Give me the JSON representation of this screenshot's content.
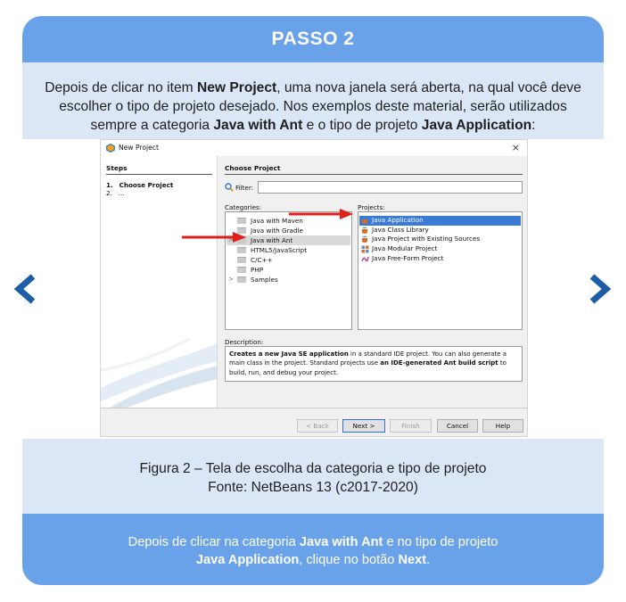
{
  "header": {
    "title": "PASSO 2"
  },
  "intro": {
    "p1": "Depois de clicar no item ",
    "b1": "New Project",
    "p2": ", uma nova janela será aberta, na qual você deve escolher o tipo de projeto desejado. Nos exemplos deste material, serão utilizados sempre a categoria ",
    "b2": "Java with Ant",
    "p3": " e o tipo de projeto ",
    "b3": "Java Application",
    "p4": ":"
  },
  "dialog": {
    "title": "New Project",
    "close": "×",
    "steps_header": "Steps",
    "steps": [
      {
        "num": "1.",
        "label": "Choose Project"
      },
      {
        "num": "2.",
        "label": "..."
      }
    ],
    "choose_header": "Choose Project",
    "filter_label": "Filter:",
    "filter_value": "",
    "categories_label": "Categories:",
    "projects_label": "Projects:",
    "categories": [
      {
        "label": "Java with Maven",
        "expander": ""
      },
      {
        "label": "Java with Gradle",
        "expander": ""
      },
      {
        "label": "Java with Ant",
        "expander": ">",
        "selected": true
      },
      {
        "label": "HTML5/JavaScript",
        "expander": ""
      },
      {
        "label": "C/C++",
        "expander": ""
      },
      {
        "label": "PHP",
        "expander": ""
      },
      {
        "label": "Samples",
        "expander": ">"
      }
    ],
    "projects": [
      {
        "label": "Java Application",
        "icon": "coffee-cup-icon",
        "selected": true
      },
      {
        "label": "Java Class Library",
        "icon": "coffee-cup-icon"
      },
      {
        "label": "Java Project with Existing Sources",
        "icon": "coffee-cup-icon"
      },
      {
        "label": "Java Modular Project",
        "icon": "modules-icon"
      },
      {
        "label": "Java Free-Form Project",
        "icon": "free-form-icon"
      }
    ],
    "description_label": "Description:",
    "description": {
      "b1": "Creates a new Java SE application",
      "t1": " in a standard IDE project. You can also generate a main class in the project. Standard projects use ",
      "b2": "an IDE-generated Ant build script",
      "t2": " to build, run, and debug your project."
    },
    "buttons": {
      "back": "< Back",
      "next": "Next >",
      "finish": "Finish",
      "cancel": "Cancel",
      "help": "Help"
    }
  },
  "caption": {
    "line1": "Figura 2 – Tela de escolha da categoria e tipo de projeto",
    "line2": "Fonte: NetBeans 13 (c2017-2020)"
  },
  "footer": {
    "p1": "Depois de clicar na categoria ",
    "b1": "Java with Ant",
    "p2": " e no tipo de projeto",
    "b2": "Java Application",
    "p3": ", clique no botão ",
    "b3": "Next",
    "p4": "."
  },
  "colors": {
    "header_blue": "#6aa2ea",
    "light_blue": "#dbe7f6",
    "nav_blue": "#1d5da8",
    "selection_blue": "#3a7bd5",
    "arrow_red": "#e0201b"
  }
}
